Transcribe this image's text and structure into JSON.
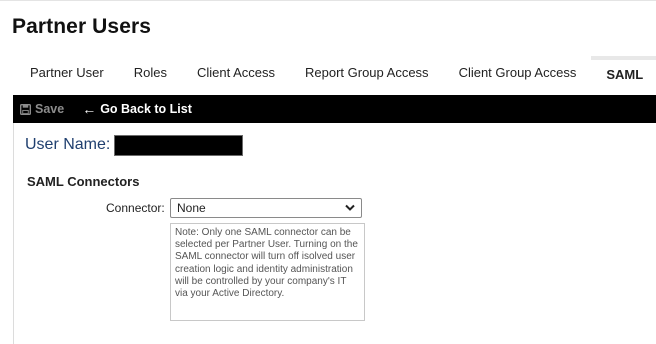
{
  "page": {
    "title": "Partner Users"
  },
  "tabs": [
    {
      "label": "Partner User",
      "active": false
    },
    {
      "label": "Roles",
      "active": false
    },
    {
      "label": "Client Access",
      "active": false
    },
    {
      "label": "Report Group Access",
      "active": false
    },
    {
      "label": "Client Group Access",
      "active": false
    },
    {
      "label": "SAML",
      "active": true
    }
  ],
  "toolbar": {
    "save_label": "Save",
    "save_icon": "floppy-disk-icon",
    "save_enabled": false,
    "back_label": "Go Back to List",
    "back_icon": "arrow-left-icon"
  },
  "user": {
    "label": "User Name:",
    "value_redacted": true
  },
  "saml": {
    "section_title": "SAML Connectors",
    "connector_label": "Connector:",
    "connector_selected": "None",
    "note": "Note: Only one SAML connector can be selected per Partner User. Turning on the SAML connector will turn off isolved user creation logic and identity administration will be controlled by your company's IT via your Active Directory."
  },
  "colors": {
    "toolbar_bg": "#000000",
    "user_label": "#1f3f6f",
    "active_tab_indicator": "#e8e8e8",
    "disabled_text": "#8c8c8c"
  }
}
